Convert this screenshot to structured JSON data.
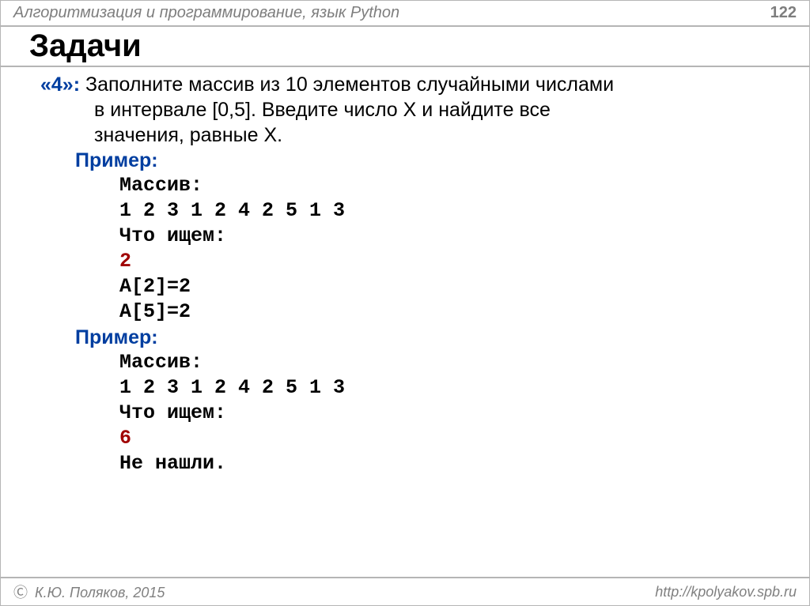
{
  "header": {
    "title": "Алгоритмизация и программирование, язык Python",
    "page": "122"
  },
  "title": "Задачи",
  "task": {
    "grade": "«4»:",
    "line1": "Заполните массив из 10 элементов случайными числами",
    "line2": "в интервале [0,5]. Введите число X и найдите все",
    "line3": "значения, равные X."
  },
  "example1": {
    "label": "Пример:",
    "arr_label": "Массив:",
    "arr_values": "1 2 3 1 2 4 2 5 1 3",
    "search_label": "Что ищем:",
    "search_value": "2",
    "result1": "A[2]=2",
    "result2": "A[5]=2"
  },
  "example2": {
    "label": "Пример:",
    "arr_label": "Массив:",
    "arr_values": "1 2 3 1 2 4 2 5 1 3",
    "search_label": "Что ищем:",
    "search_value": "6",
    "result": "Не нашли."
  },
  "footer": {
    "copyright": "К.Ю. Поляков, 2015",
    "url": "http://kpolyakov.spb.ru"
  }
}
